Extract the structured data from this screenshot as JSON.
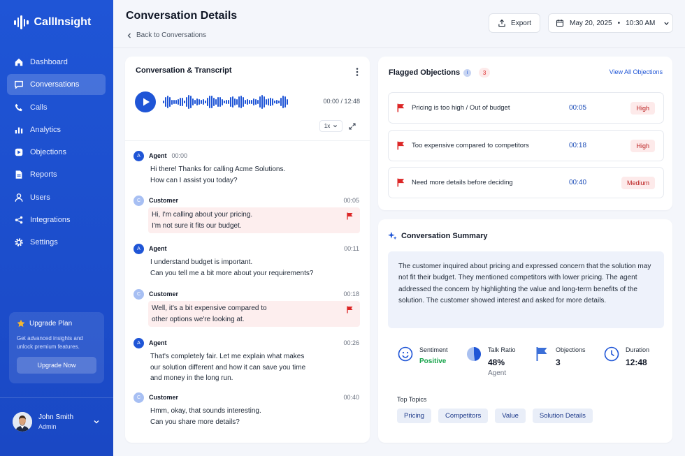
{
  "app": {
    "name": "CallInsight"
  },
  "nav": [
    {
      "label": "Dashboard",
      "icon": "home-icon"
    },
    {
      "label": "Conversations",
      "icon": "chat-icon",
      "active": true
    },
    {
      "label": "Calls",
      "icon": "phone-icon"
    },
    {
      "label": "Analytics",
      "icon": "bar-chart-icon"
    },
    {
      "label": "Objections",
      "icon": "objection-icon"
    },
    {
      "label": "Reports",
      "icon": "document-icon"
    },
    {
      "label": "Users",
      "icon": "user-icon"
    },
    {
      "label": "Integrations",
      "icon": "integrations-icon"
    },
    {
      "label": "Settings",
      "icon": "gear-icon"
    }
  ],
  "upgrade": {
    "title": "Upgrade Plan",
    "desc": "Get advanced insights and unlock premium features.",
    "button": "Upgrade Now"
  },
  "user": {
    "name": "John Smith",
    "role": "Admin"
  },
  "header": {
    "title": "Conversation Details",
    "back": "Back to Conversations",
    "export": "Export",
    "date": "May 20, 2025",
    "time": "10:30 AM"
  },
  "transcript": {
    "title": "Conversation & Transcript",
    "time": "00:00 / 12:48",
    "speed": "1x",
    "messages": [
      {
        "speaker": "Agent",
        "initial": "A",
        "time": "00:00",
        "text": "Hi there! Thanks for calling Acme Solutions.\nHow can I assist you today?"
      },
      {
        "speaker": "Customer",
        "initial": "C",
        "time": "00:05",
        "text": "Hi, I'm calling about your pricing.\nI'm not sure it fits our budget."
      },
      {
        "speaker": "Agent",
        "initial": "A",
        "time": "00:11",
        "text": "I understand budget is important.\nCan you tell me a bit more about your requirements?"
      },
      {
        "speaker": "Customer",
        "initial": "C",
        "time": "00:18",
        "text": "Well, it's a bit expensive compared to\nother options we're looking at."
      },
      {
        "speaker": "Agent",
        "initial": "A",
        "time": "00:26",
        "text": "That's completely fair. Let me explain what makes\nour solution different and how it can save you time\nand money in the long run."
      },
      {
        "speaker": "Customer",
        "initial": "C",
        "time": "00:40",
        "text": "Hmm, okay, that sounds interesting.\nCan you share more details?"
      }
    ]
  },
  "objections": {
    "title": "Flagged Objections",
    "info": "i",
    "count": "3",
    "view_all": "View All Objections",
    "items": [
      {
        "text": "Pricing is too high / Out of budget",
        "time": "00:05",
        "level": "High"
      },
      {
        "text": "Too expensive compared to competitors",
        "time": "00:18",
        "level": "High"
      },
      {
        "text": "Need more details before deciding",
        "time": "00:40",
        "level": "Medium"
      }
    ]
  },
  "summary": {
    "title": "Conversation Summary",
    "text": "The customer inquired about pricing and expressed concern that the solution may not fit their budget. They mentioned competitors with lower pricing. The agent addressed the concern by highlighting the value and long-term benefits of the solution. The customer showed interest and asked for more details.",
    "stats": {
      "sentiment_label": "Sentiment",
      "sentiment_value": "Positive",
      "talk_label": "Talk Ratio",
      "talk_value": "48%",
      "talk_sub": "Agent",
      "talk_fraction": 0.48,
      "obj_label": "Objections",
      "obj_value": "3",
      "dur_label": "Duration",
      "dur_value": "12:48"
    },
    "topics_label": "Top Topics",
    "topics": [
      "Pricing",
      "Competitors",
      "Value",
      "Solution Details"
    ]
  },
  "colors": {
    "accent": "#1f55d6",
    "flag": "#dc2626",
    "positive": "#16a34a"
  }
}
